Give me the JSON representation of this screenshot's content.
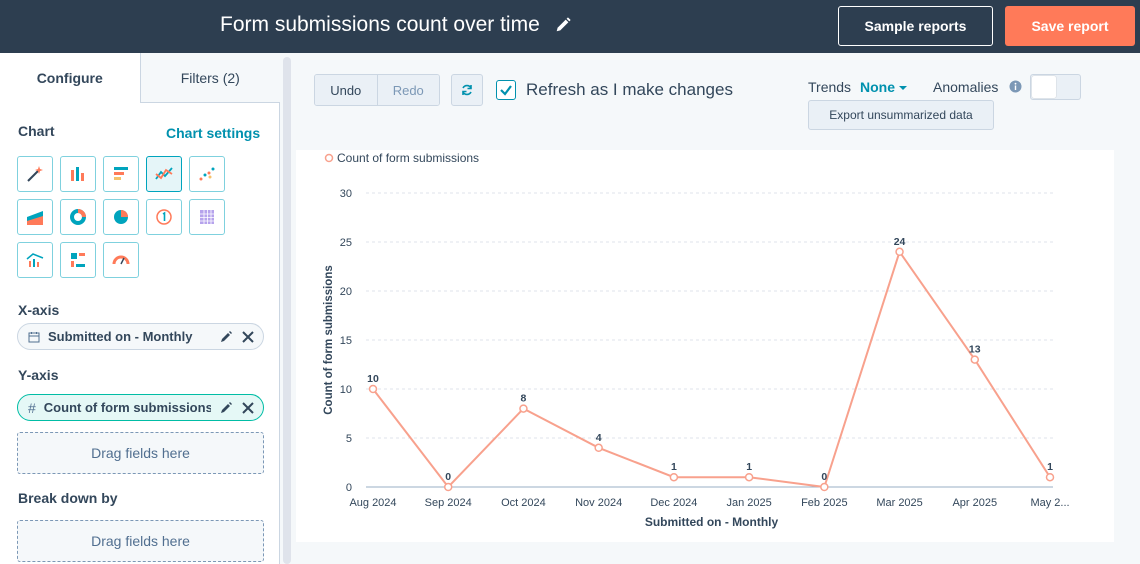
{
  "header": {
    "title": "Form submissions count over time",
    "sample_reports": "Sample reports",
    "save_report": "Save report"
  },
  "sidebar": {
    "tabs": [
      {
        "label": "Configure"
      },
      {
        "label": "Filters (2)"
      }
    ],
    "chart_heading": "Chart",
    "chart_settings": "Chart settings",
    "chart_types": [
      "magic-wand-icon",
      "vertical-bar-icon",
      "horizontal-bar-icon",
      "line-chart-icon",
      "scatter-icon",
      "area-chart-icon",
      "donut-icon",
      "pie-icon",
      "kpi-icon",
      "pivot-table-icon",
      "combo-chart-icon",
      "summary-icon",
      "gauge-icon"
    ],
    "selected_chart_type": "line-chart-icon",
    "xaxis_heading": "X-axis",
    "xaxis_field": "Submitted on - Monthly",
    "yaxis_heading": "Y-axis",
    "yaxis_field": "Count of form submissions",
    "drag_here": "Drag fields here",
    "breakdown_heading": "Break down by",
    "drag_here_2": "Drag fields here"
  },
  "toolbar": {
    "undo": "Undo",
    "redo": "Redo",
    "refresh_label": "Refresh as I make changes",
    "refresh_checked": true,
    "trends_label": "Trends",
    "trends_value": "None",
    "anomalies_label": "Anomalies",
    "anomalies_on": false,
    "export": "Export unsummarized data"
  },
  "colors": {
    "header_bg": "#2d3e50",
    "save_button": "#ff7a59",
    "accent": "#0091ae",
    "series": "#f8a18d"
  },
  "chart_data": {
    "type": "line",
    "legend": "Count of form submissions",
    "legend_position": "top-left",
    "xlabel": "Submitted on - Monthly",
    "ylabel": "Count of form submissions",
    "ylim": [
      0,
      30
    ],
    "yticks": [
      0,
      5,
      10,
      15,
      20,
      25,
      30
    ],
    "grid": true,
    "categories": [
      "Aug 2024",
      "Sep 2024",
      "Oct 2024",
      "Nov 2024",
      "Dec 2024",
      "Jan 2025",
      "Feb 2025",
      "Mar 2025",
      "Apr 2025",
      "May 2..."
    ],
    "series": [
      {
        "name": "Count of form submissions",
        "values": [
          10,
          0,
          8,
          4,
          1,
          1,
          0,
          24,
          13,
          1
        ]
      }
    ]
  }
}
